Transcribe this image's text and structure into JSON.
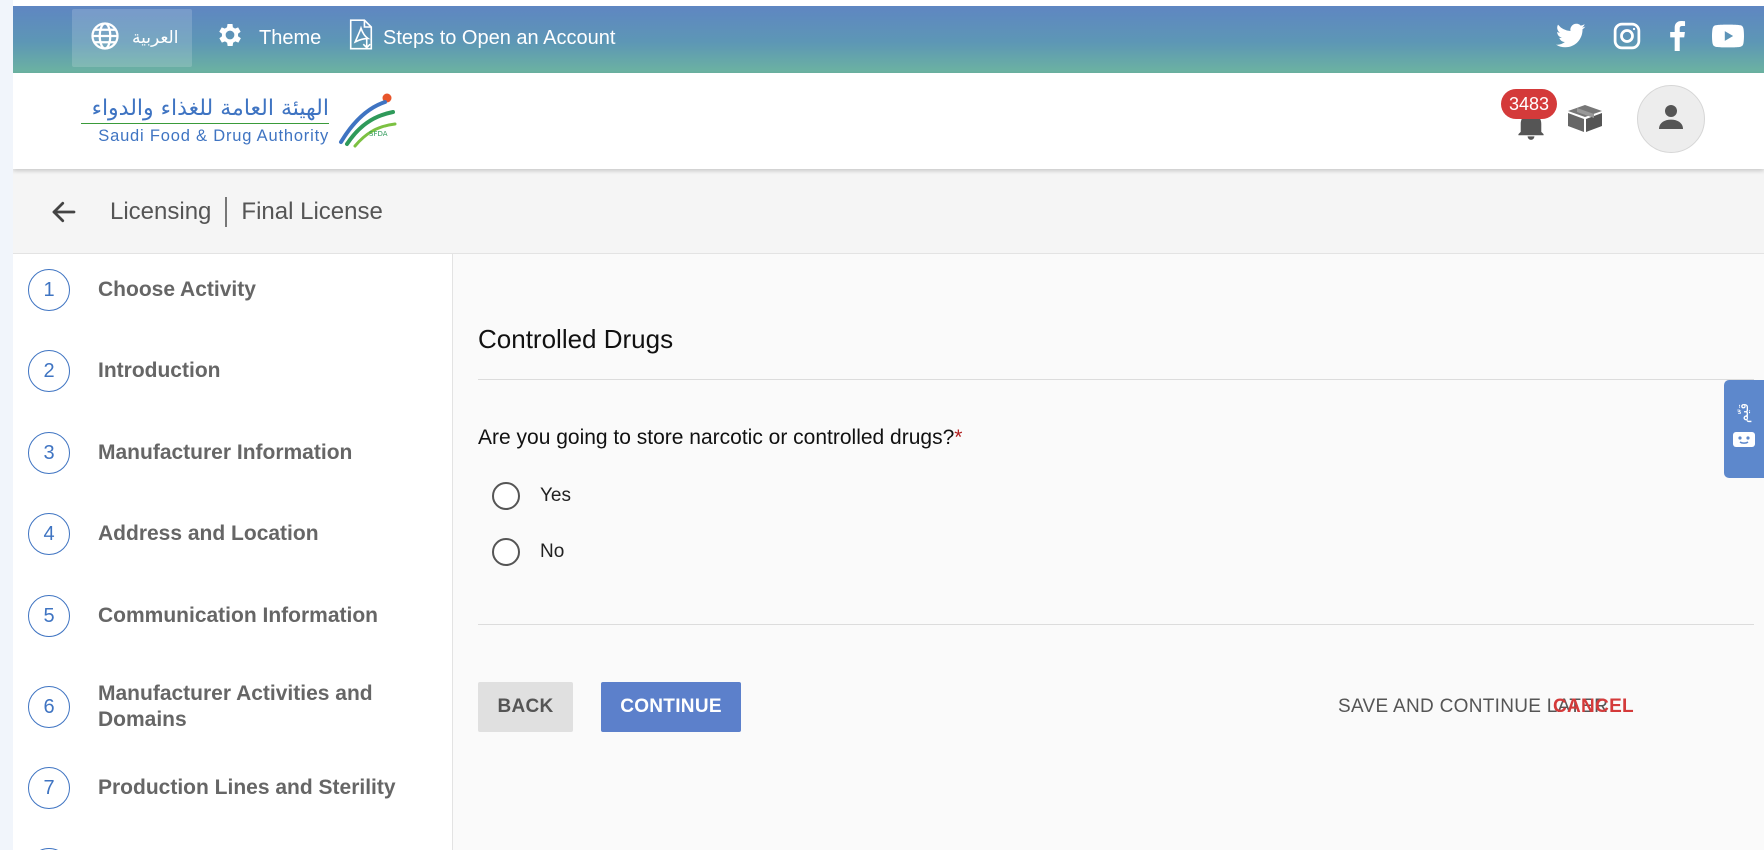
{
  "topbar": {
    "language_label": "العربية",
    "theme_label": "Theme",
    "steps_label": "Steps to Open an Account",
    "socials": [
      "twitter-icon",
      "instagram-icon",
      "facebook-icon",
      "youtube-icon"
    ]
  },
  "header": {
    "logo_ar": "الهيئة العامة للغذاء والدواء",
    "logo_en": "Saudi Food & Drug Authority",
    "logo_mark": "SFDA",
    "notification_count": "3483"
  },
  "breadcrumb": {
    "part1": "Licensing",
    "part2": "Final License"
  },
  "sidebar": {
    "steps": [
      {
        "num": "1",
        "label": "Choose Activity"
      },
      {
        "num": "2",
        "label": "Introduction"
      },
      {
        "num": "3",
        "label": "Manufacturer Information"
      },
      {
        "num": "4",
        "label": "Address and Location"
      },
      {
        "num": "5",
        "label": "Communication Information"
      },
      {
        "num": "6",
        "label": "Manufacturer Activities and Domains"
      },
      {
        "num": "7",
        "label": "Production Lines and Sterility"
      }
    ]
  },
  "main": {
    "section_title": "Controlled Drugs",
    "question": "Are you going to store narcotic or controlled drugs?",
    "required_mark": "*",
    "options": [
      "Yes",
      "No"
    ],
    "back_label": "BACK",
    "continue_label": "CONTINUE",
    "save_label": "SAVE AND CONTINUE LATER",
    "cancel_label": "CANCEL"
  },
  "side_tab": {
    "label": "قيّم"
  },
  "colors": {
    "primary": "#5c80cb",
    "danger": "#d43a3a",
    "step_blue": "#3f74c2"
  }
}
